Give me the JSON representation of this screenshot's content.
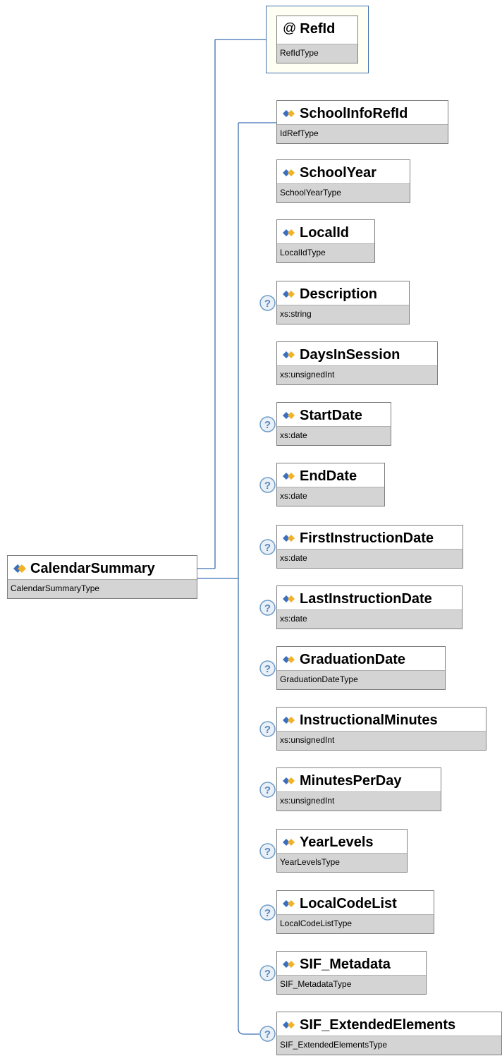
{
  "root": {
    "name": "CalendarSummary",
    "type": "CalendarSummaryType"
  },
  "attribute": {
    "symbol": "@",
    "name": "RefId",
    "type": "RefIdType"
  },
  "elements": [
    {
      "name": "SchoolInfoRefId",
      "type": "IdRefType",
      "optional": false
    },
    {
      "name": "SchoolYear",
      "type": "SchoolYearType",
      "optional": false
    },
    {
      "name": "LocalId",
      "type": "LocalIdType",
      "optional": false
    },
    {
      "name": "Description",
      "type": "xs:string",
      "optional": true
    },
    {
      "name": "DaysInSession",
      "type": "xs:unsignedInt",
      "optional": false
    },
    {
      "name": "StartDate",
      "type": "xs:date",
      "optional": true
    },
    {
      "name": "EndDate",
      "type": "xs:date",
      "optional": true
    },
    {
      "name": "FirstInstructionDate",
      "type": "xs:date",
      "optional": true
    },
    {
      "name": "LastInstructionDate",
      "type": "xs:date",
      "optional": true
    },
    {
      "name": "GraduationDate",
      "type": "GraduationDateType",
      "optional": true
    },
    {
      "name": "InstructionalMinutes",
      "type": "xs:unsignedInt",
      "optional": true
    },
    {
      "name": "MinutesPerDay",
      "type": "xs:unsignedInt",
      "optional": true
    },
    {
      "name": "YearLevels",
      "type": "YearLevelsType",
      "optional": true
    },
    {
      "name": "LocalCodeList",
      "type": "LocalCodeListType",
      "optional": true
    },
    {
      "name": "SIF_Metadata",
      "type": "SIF_MetadataType",
      "optional": true
    },
    {
      "name": "SIF_ExtendedElements",
      "type": "SIF_ExtendedElementsType",
      "optional": true
    }
  ],
  "optional_symbol": "?",
  "colors": {
    "connector": "#3f6fb4",
    "type_band": "#d4d4d4",
    "border": "#7f7f7f",
    "attribute_bg": "#fffff4",
    "optional_badge": "#6d9cc7"
  }
}
